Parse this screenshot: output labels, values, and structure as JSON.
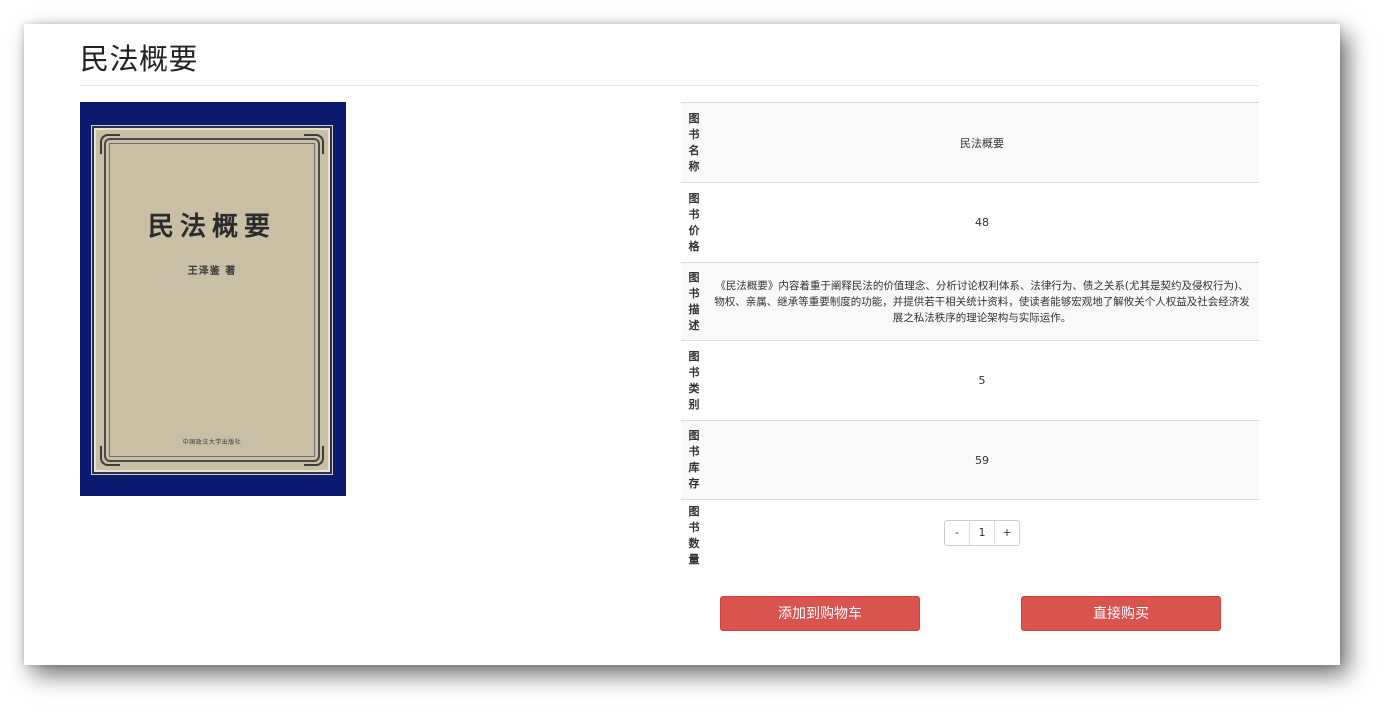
{
  "page": {
    "title": "民法概要"
  },
  "cover": {
    "title": "民法概要",
    "author": "王泽鉴 著",
    "publisher": "中国政法大学出版社"
  },
  "details": {
    "rows": [
      {
        "label": "图书名称",
        "value": "民法概要"
      },
      {
        "label": "图书价格",
        "value": "48"
      },
      {
        "label": "图书描述",
        "value": "《民法概要》内容着重于阐释民法的价值理念、分析讨论权利体系、法律行为、债之关系(尤其是契约及侵权行为)、物权、亲属、继承等重要制度的功能，并提供若干相关统计资料，使读者能够宏观地了解攸关个人权益及社会经济发展之私法秩序的理论架构与实际运作。"
      },
      {
        "label": "图书类别",
        "value": "5"
      },
      {
        "label": "图书库存",
        "value": "59"
      },
      {
        "label": "图书数量",
        "value": ""
      }
    ],
    "quantity": {
      "minus": "-",
      "value": "1",
      "plus": "+"
    }
  },
  "actions": {
    "add_to_cart": "添加到购物车",
    "buy_now": "直接购买"
  }
}
